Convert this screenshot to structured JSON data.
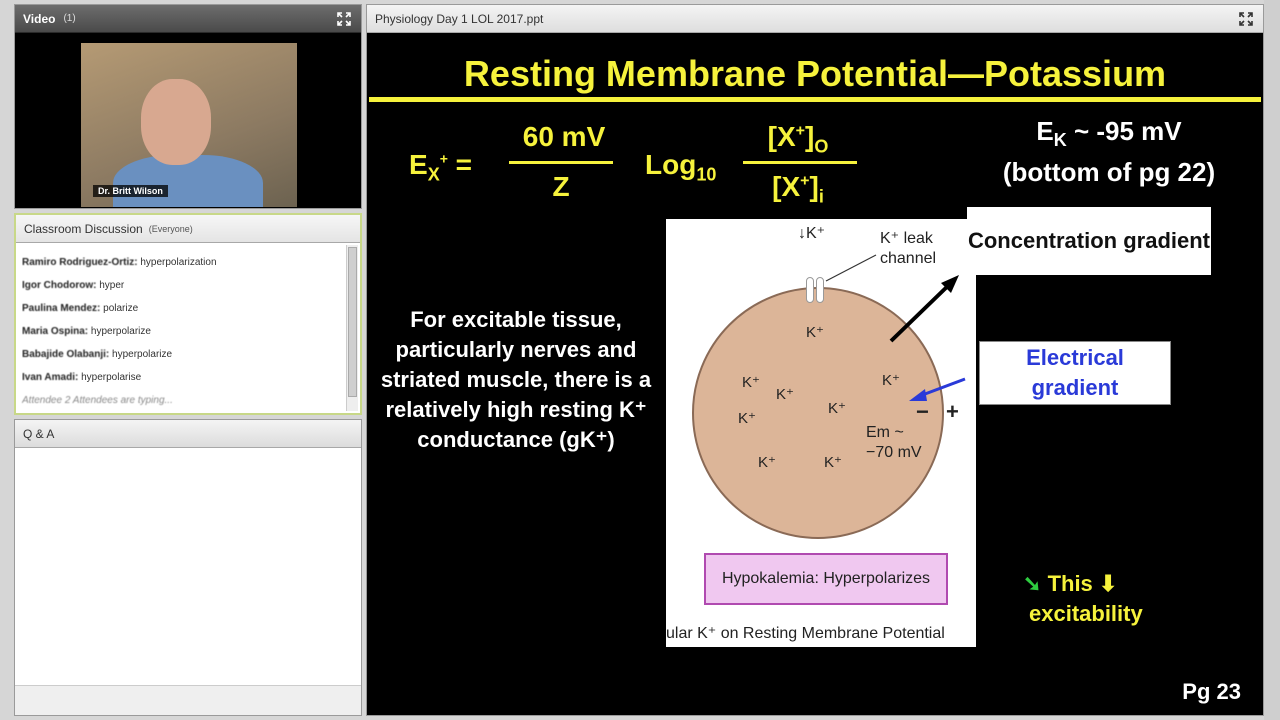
{
  "video_pod": {
    "title": "Video",
    "count": "(1)",
    "presenter_name": "Dr. Britt Wilson"
  },
  "chat_pod": {
    "title": "Classroom Discussion",
    "audience": "(Everyone)",
    "messages": [
      {
        "sender": "Ramiro Rodriguez-Ortiz:",
        "text": "hyperpolarization"
      },
      {
        "sender": "Igor Chodorow:",
        "text": "hyper"
      },
      {
        "sender": "Paulina Mendez:",
        "text": "polarize"
      },
      {
        "sender": "Maria Ospina:",
        "text": "hyperpolarize"
      },
      {
        "sender": "Babajide Olabanji:",
        "text": "hyperpolarize"
      },
      {
        "sender": "Ivan Amadi:",
        "text": "hyperpolarise"
      }
    ],
    "typing": "Attendee 2 Attendees are typing..."
  },
  "qa_pod": {
    "title": "Q & A"
  },
  "share_pod": {
    "title": "Physiology Day 1 LOL 2017.ppt"
  },
  "slide": {
    "title": "Resting Membrane Potential—Potassium",
    "eq_lhs": "E",
    "eq_lhs_sub": "X",
    "eq_lhs_sup": "+",
    "eq_equals": "=",
    "eq_num": "60 mV",
    "eq_den": "Z",
    "eq_log": "Log",
    "eq_log_sub": "10",
    "eq_conc_num": "[X",
    "eq_conc_num_sup": "+",
    "eq_conc_num_close": "]",
    "eq_conc_num_sub": "O",
    "eq_conc_den": "[X",
    "eq_conc_den_sup": "+",
    "eq_conc_den_close": "]",
    "eq_conc_den_sub": "i",
    "ek_line1_e": "E",
    "ek_line1_sub": "K",
    "ek_line1_rest": " ~ -95 mV",
    "ek_line2": "(bottom of pg 22)",
    "body": "For excitable tissue, particularly nerves and striated muscle, there is a relatively high resting K⁺ conductance (gK⁺)",
    "concentration_gradient": "Concentration gradient",
    "electrical_gradient": "Electrical gradient",
    "this_word": "This",
    "excitability": "excitability",
    "page": "Pg 23",
    "figure": {
      "k_top": "↓K⁺",
      "leak_label_1": "K⁺ leak",
      "leak_label_2": "channel",
      "k_ion": "K⁺",
      "minus": "−",
      "plus": "+",
      "em_1": "Em ~",
      "em_2": "−70 mV",
      "hypo": "Hypokalemia: Hyperpolarizes",
      "caption": "ular K⁺ on Resting Membrane Potential"
    }
  },
  "colors": {
    "slide_yellow": "#f6f23c",
    "electrical_blue": "#2a3ad8",
    "hypo_fill": "#f0c8f0",
    "arrow_green": "#2ecc40"
  }
}
